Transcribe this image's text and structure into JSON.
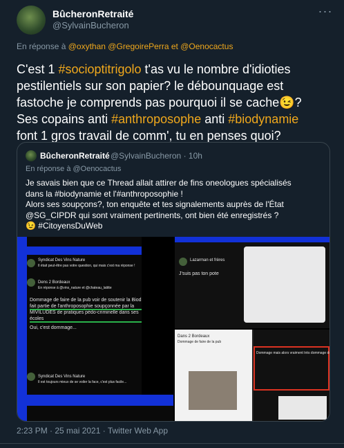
{
  "author": {
    "name": "BûcheronRetraité",
    "handle": "@SylvainBucheron"
  },
  "reply_to": {
    "prefix": "En réponse à",
    "users": [
      "@oxythan",
      "@GregoirePerra",
      "et",
      "@Oenocactus"
    ]
  },
  "tweet_text": {
    "line1_pre": "C'est 1 ",
    "line1_tag": "#socioptitrigolo",
    "line1_post": " t'as vu le nombre d'idioties",
    "line2": "pestilentiels sur son papier? le débounquage est",
    "line3": "fastoche je comprends pas pourquoi il se cache😉?",
    "line4_pre": "Ses copains anti ",
    "line4_tag1": "#anthroposophe",
    "line4_mid": " anti ",
    "line4_tag2": "#biodynamie",
    "line5": "font 1 gros travail de comm', tu en penses quoi?"
  },
  "quoted": {
    "name": "BûcheronRetraité",
    "handle_time": "@SylvainBucheron · 10h",
    "reply_prefix": "En réponse à",
    "reply_user": "@Oenocactus",
    "line1": "Je savais bien que ce Thread allait attirer de fins  oneologues spécialisés",
    "line2": "dans la #biodynamie et l'#anthroposophie !",
    "line3": "Alors ses soupçons?, ton enquête et tes signalements  auprès de l'État",
    "line4": "@SG_CIPDR qui sont vraiment pertinents, ont bien été enregistrés ?",
    "line5": "😉 #CitoyensDuWeb"
  },
  "media": {
    "img1_lines": [
      "Syndicat Des Vins Nature",
      "Il était peut-être pas votre question, qui mais c'est ma réponse !",
      "Dens 2 Bordeaux",
      "En réponse à @vins_nature et @chateau_latitte",
      "Dommage de faire de la pub voir de soutenir la Biod qui",
      "fait partie de l'anthroposophie soupçonnée par la",
      "MIVILUDES de pratiques pédo-criminelle dans ses",
      "écoles",
      "Oui, c'est dommage...",
      "Syndicat Des Vins Nature",
      "Il est toujours mieux de se voiler la face, c'est plus facile..."
    ],
    "img2_lines": [
      "Lazarman et frères",
      "J'suis pas ton pote"
    ],
    "img3_lines": [
      "Dans 2 Bordeaux",
      "Dommage de faire de la pub",
      "Dommage mais alors vraiment très dommage de faire de la pub"
    ]
  },
  "footer": "2:23 PM · 25 mai 2021 · Twitter Web App",
  "colors": {
    "background": "#15202b",
    "accent": "#f0a81c",
    "muted": "#8899a6",
    "border": "#38444d"
  }
}
